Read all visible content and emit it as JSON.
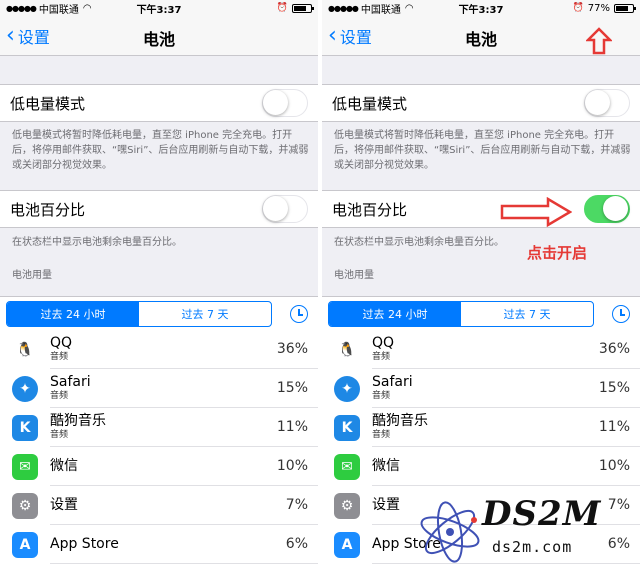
{
  "status_left": {
    "carrier": "中国联通",
    "time": "下午3:37"
  },
  "status_right": {
    "carrier": "中国联通",
    "time": "下午3:37",
    "battery_text": "77%"
  },
  "nav": {
    "back_label": "设置",
    "title": "电池"
  },
  "low_power": {
    "label": "低电量模式",
    "note": "低电量模式将暂时降低耗电量，直至您 iPhone 完全充电。打开后，将停用邮件获取、“嘿Siri”、后台应用刷新与自动下载，并减弱或关闭部分视觉效果。",
    "on": false
  },
  "battery_pct": {
    "label": "电池百分比",
    "note": "在状态栏中显示电池剩余电量百分比。",
    "left_on": false,
    "right_on": true
  },
  "usage": {
    "header": "电池用量",
    "tabs": [
      "过去 24 小时",
      "过去 7 天"
    ],
    "apps": [
      {
        "name": "QQ",
        "sub": "音频",
        "pct": "36%",
        "icon": "qq-icon",
        "glyph": "🐧"
      },
      {
        "name": "Safari",
        "sub": "音频",
        "pct": "15%",
        "icon": "safari-icon",
        "glyph": "✦"
      },
      {
        "name": "酷狗音乐",
        "sub": "音频",
        "pct": "11%",
        "icon": "kugou-icon",
        "glyph": "K"
      },
      {
        "name": "微信",
        "sub": "",
        "pct": "10%",
        "icon": "wechat-icon",
        "glyph": "✉"
      },
      {
        "name": "设置",
        "sub": "",
        "pct": "7%",
        "icon": "settings-icon",
        "glyph": "⚙"
      },
      {
        "name": "App Store",
        "sub": "",
        "pct": "6%",
        "icon": "appstore-icon",
        "glyph": "A"
      }
    ]
  },
  "annotation": {
    "text": "点击开启"
  },
  "watermark": {
    "big": "DS2M",
    "small": "ds2m.com"
  },
  "colors": {
    "ios_blue": "#007aff",
    "toggle_green": "#4cd964",
    "annotation_red": "#e53935"
  }
}
